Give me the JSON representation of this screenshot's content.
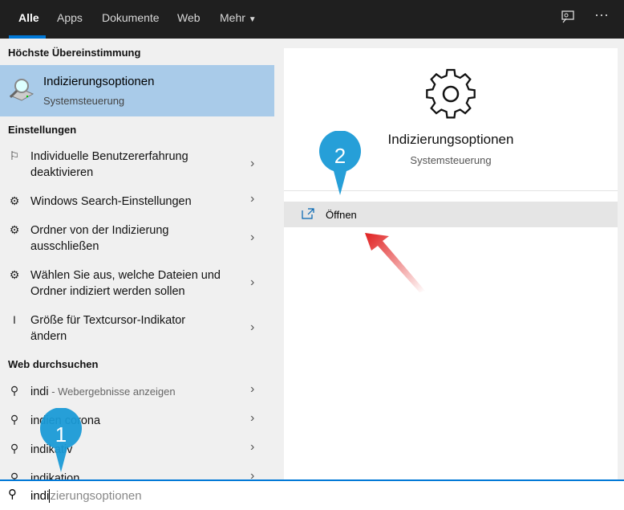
{
  "tabs": [
    "Alle",
    "Apps",
    "Dokumente",
    "Web",
    "Mehr"
  ],
  "best_match": {
    "header": "Höchste Übereinstimmung",
    "title": "Indizierungsoptionen",
    "subtitle": "Systemsteuerung"
  },
  "settings": {
    "header": "Einstellungen",
    "items": [
      {
        "icon": "feedback-icon",
        "line1": "Individuelle Benutzererfahrung",
        "line2": "deaktivieren"
      },
      {
        "icon": "gear-icon",
        "line1": "Windows Search-Einstellungen",
        "line2": ""
      },
      {
        "icon": "gear-icon",
        "line1": "Ordner von der Indizierung",
        "line2": "ausschließen"
      },
      {
        "icon": "gear-icon",
        "line1": "Wählen Sie aus, welche Dateien und",
        "line2": "Ordner indiziert werden sollen"
      },
      {
        "icon": "text-cursor-icon",
        "line1": "Größe für Textcursor-Indikator",
        "line2": "ändern"
      }
    ]
  },
  "web": {
    "header": "Web durchsuchen",
    "items": [
      {
        "text": "indi",
        "hint": " - Webergebnisse anzeigen"
      },
      {
        "text": "indien corona",
        "hint": ""
      },
      {
        "text": "indikativ",
        "hint": ""
      },
      {
        "text": "indikation",
        "hint": ""
      }
    ]
  },
  "preview": {
    "title": "Indizierungsoptionen",
    "subtitle": "Systemsteuerung",
    "open_label": "Öffnen"
  },
  "search": {
    "typed": "indi",
    "completion": "zierungsoptionen"
  },
  "markers": {
    "one": "1",
    "two": "2"
  },
  "colors": {
    "accent": "#0078d7",
    "selected": "#a9cbe9",
    "marker": "#1a9ad6",
    "arrow": "#e02020"
  }
}
